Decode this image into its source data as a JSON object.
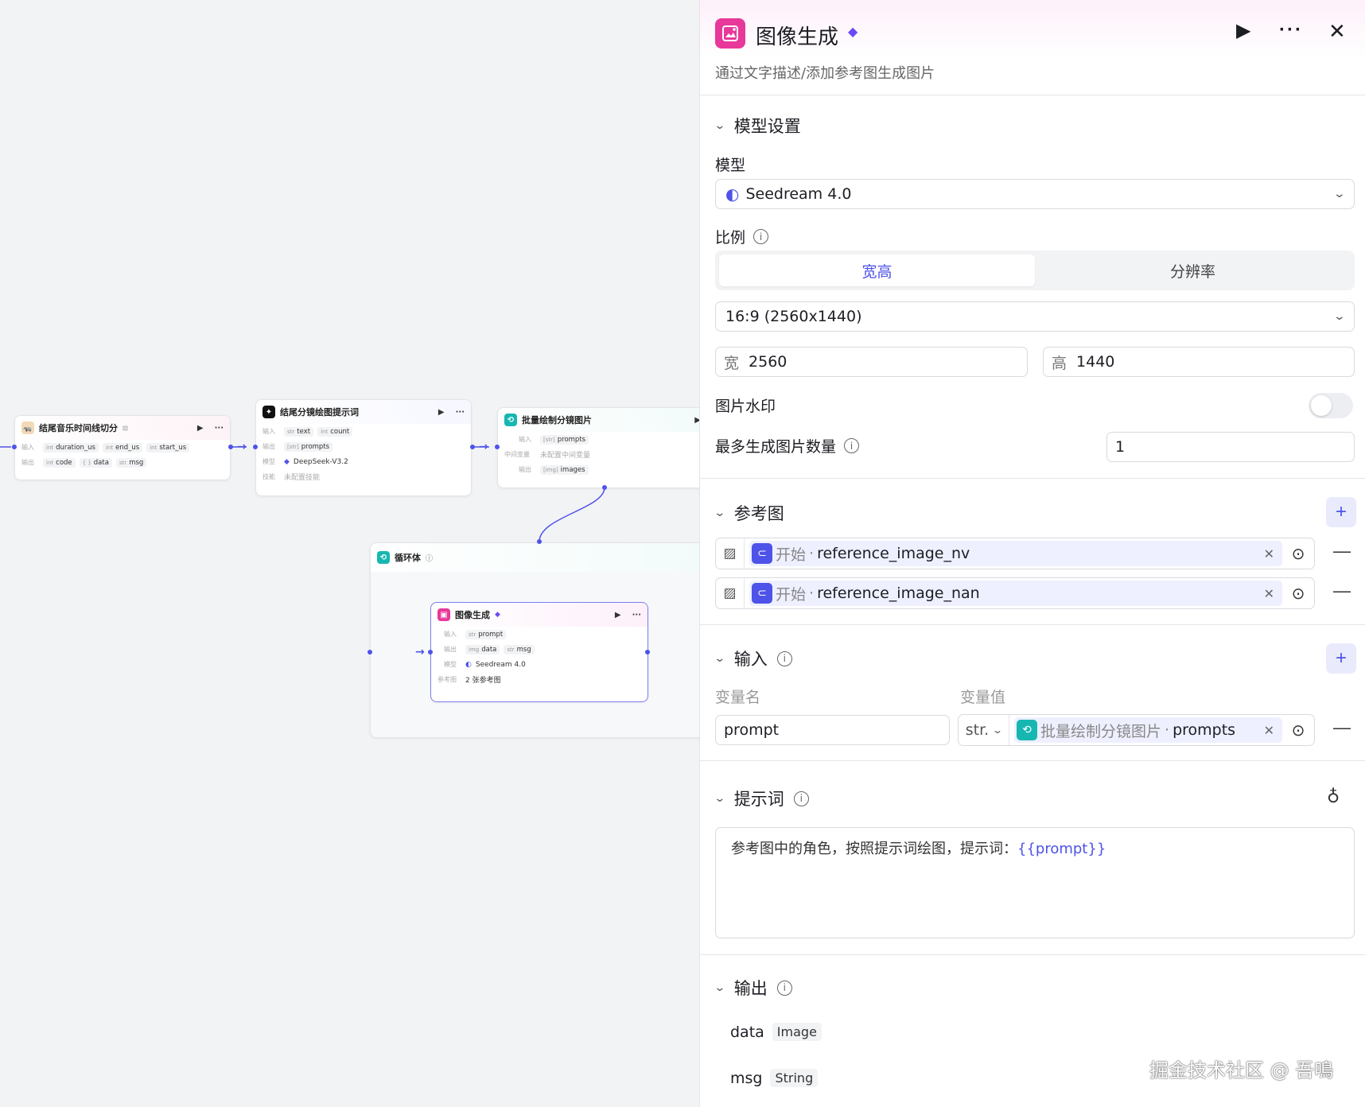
{
  "canvas": {
    "node_audio": {
      "title": "结尾音乐时间线切分",
      "input_label": "输入",
      "output_label": "输出",
      "inputs": [
        {
          "type": "int",
          "name": "duration_us"
        },
        {
          "type": "int",
          "name": "end_us"
        },
        {
          "type": "int",
          "name": "start_us"
        }
      ],
      "outputs": [
        {
          "type": "int",
          "name": "code"
        },
        {
          "type": "{ }",
          "name": "data"
        },
        {
          "type": "str",
          "name": "msg"
        }
      ]
    },
    "node_prompt": {
      "title": "结尾分镜绘图提示词",
      "input_label": "输入",
      "output_label": "输出",
      "model_label": "模型",
      "skill_label": "技能",
      "inputs": [
        {
          "type": "str",
          "name": "text"
        },
        {
          "type": "int",
          "name": "count"
        }
      ],
      "output": {
        "type": "[str]",
        "name": "prompts"
      },
      "model": "DeepSeek-V3.2",
      "skill": "未配置技能"
    },
    "node_batch": {
      "title": "批量绘制分镜图片",
      "input_label": "输入",
      "mid_label": "中间变量",
      "output_label": "输出",
      "input": {
        "type": "[str]",
        "name": "prompts"
      },
      "mid": "未配置中间变量",
      "output": {
        "type": "[img]",
        "name": "images"
      }
    },
    "loop": {
      "title": "循环体"
    },
    "node_image": {
      "title": "图像生成",
      "input_label": "输入",
      "output_label": "输出",
      "model_label": "模型",
      "ref_label": "参考图",
      "input": {
        "type": "str",
        "name": "prompt"
      },
      "outputs": [
        {
          "type": "img",
          "name": "data"
        },
        {
          "type": "str",
          "name": "msg"
        }
      ],
      "model": "Seedream 4.0",
      "ref": "2 张参考图"
    }
  },
  "panel": {
    "title": "图像生成",
    "description": "通过文字描述/添加参考图生成图片",
    "model_section": {
      "title": "模型设置",
      "model_label": "模型",
      "model_value": "Seedream 4.0",
      "ratio_label": "比例",
      "tabs": [
        "宽高",
        "分辨率"
      ],
      "ratio_value": "16:9 (2560x1440)",
      "width_label": "宽",
      "width_value": "2560",
      "height_label": "高",
      "height_value": "1440",
      "watermark_label": "图片水印",
      "watermark_on": false,
      "max_count_label": "最多生成图片数量",
      "max_count_value": "1"
    },
    "ref_section": {
      "title": "参考图",
      "items": [
        {
          "source": "开始",
          "sep": " · ",
          "name": "reference_image_nv"
        },
        {
          "source": "开始",
          "sep": " · ",
          "name": "reference_image_nan"
        }
      ]
    },
    "input_section": {
      "title": "输入",
      "col_name": "变量名",
      "col_value": "变量值",
      "var_name": "prompt",
      "var_type": "str.",
      "var_source": "批量绘制分镜图片",
      "var_sep": " · ",
      "var_ref": "prompts"
    },
    "prompt_section": {
      "title": "提示词",
      "text": "参考图中的角色，按照提示词绘图，提示词：",
      "var": "{{prompt}}"
    },
    "output_section": {
      "title": "输出",
      "items": [
        {
          "name": "data",
          "type": "Image"
        },
        {
          "name": "msg",
          "type": "String"
        }
      ]
    }
  },
  "watermark": "掘金技术社区 @ 吾鳴",
  "colors": {
    "accent": "#4d53e8",
    "node_pink": "#e8389a",
    "node_teal": "#16b7b1"
  }
}
